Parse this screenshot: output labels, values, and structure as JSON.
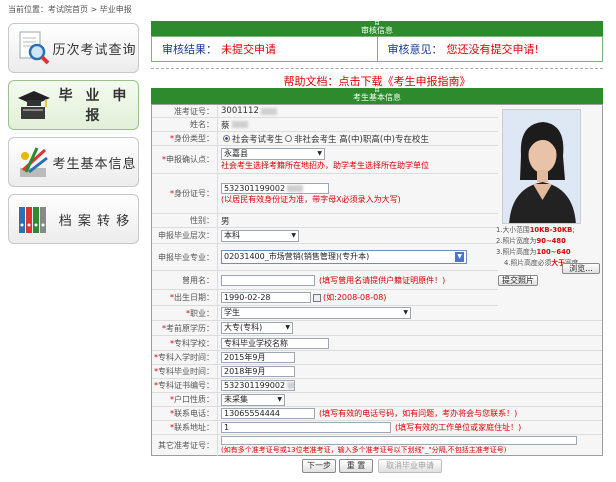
{
  "breadcrumb": {
    "prefix": "当前位置：",
    "home": "考试院首页",
    "sep": " > ",
    "current": "毕业申报"
  },
  "nav": [
    {
      "label": "历次考试查询",
      "icon": "document-search-icon"
    },
    {
      "label": "毕 业 申 报",
      "icon": "graduation-cap-icon"
    },
    {
      "label": "考生基本信息",
      "icon": "stationery-icon"
    },
    {
      "label": "档 案 转 移",
      "icon": "binders-icon"
    }
  ],
  "review_header": "审核信息",
  "review": {
    "result_label": "审核结果：",
    "result_value": "未提交申请",
    "opinion_label": "审核意见：",
    "opinion_value": "您还没有提交申请!"
  },
  "help": {
    "text": "帮助文档：点击下载《考生申报指南》"
  },
  "form_header": "考生基本信息",
  "fields": {
    "exam_no": {
      "label": "准考证号：",
      "value": "3001112"
    },
    "name": {
      "label": "姓名：",
      "value": "蔡"
    },
    "identity": {
      "label": "身份类型：",
      "opt1": "社会考试考生",
      "opt2": "非社会考生 高(中)职高(中)专在校生"
    },
    "location": {
      "label": "申报确认点：",
      "value": "永嘉县",
      "note": "社会考生选择考籍所在地招办，助学考生选择所在助学单位"
    },
    "id_card": {
      "label": "身份证号：",
      "value": "532301199002",
      "note": "(以居民有效身份证为准，带字母X必须录入为大写)"
    },
    "gender": {
      "label": "性别：",
      "value": "男"
    },
    "level": {
      "label": "申报毕业层次：",
      "value": "本科"
    },
    "major": {
      "label": "申报毕业专业：",
      "value": "02031400_市场营销(销售管理)(专升本)"
    },
    "former_name": {
      "label": "曾用名：",
      "value": "",
      "note": "(填写曾用名请提供户籍证明原件！)"
    },
    "birth": {
      "label": "出生日期：",
      "value": "1990-02-28",
      "note": "(如:2008-08-08)"
    },
    "job": {
      "label": "职业：",
      "value": "学生"
    },
    "pre_edu": {
      "label": "考前原学历：",
      "value": "大专(专科)"
    },
    "college": {
      "label": "专科学校：",
      "value": "专科毕业学校名称"
    },
    "enroll_date": {
      "label": "专科入学时间：",
      "value": "2015年9月"
    },
    "grad_date": {
      "label": "专科毕业时间：",
      "value": "2018年9月"
    },
    "cert_no": {
      "label": "专科证书编号：",
      "value": "532301199002"
    },
    "hukou": {
      "label": "户口性质：",
      "value": "未采集"
    },
    "phone": {
      "label": "联系电话：",
      "value": "13065554444",
      "note": "(填写有效的电话号码，如有问题，考办将会与您联系！)"
    },
    "address": {
      "label": "联系地址：",
      "value": "1",
      "note": "(填写有效的工作单位或家庭住址！)"
    },
    "other_no": {
      "label": "其它准考证号：",
      "value": "",
      "note": "(如有多个准考证号或13位老准考证，输入多个准考证号以下划线\"_\"分隔,不包括主准考证号)"
    }
  },
  "photo_notes": {
    "l1a": "1.大小范围",
    "l1b": "10KB-30KB",
    "l1c": ";",
    "l2a": "2.照片宽度为",
    "l2b": "90~480",
    "l3a": "3.照片高度为",
    "l3b": "100~640",
    "l4a": "4.照片高度必须",
    "l4b": "大于",
    "l4c": "宽度。"
  },
  "buttons": {
    "browse": "浏览...",
    "upload": "提交照片",
    "next": "下一步",
    "reset": "重 置",
    "submit": "取消毕业申请"
  },
  "colors": {
    "header_green": "#2d8a2d",
    "warn_red": "#e00000",
    "link_blue": "#1a3a99"
  }
}
